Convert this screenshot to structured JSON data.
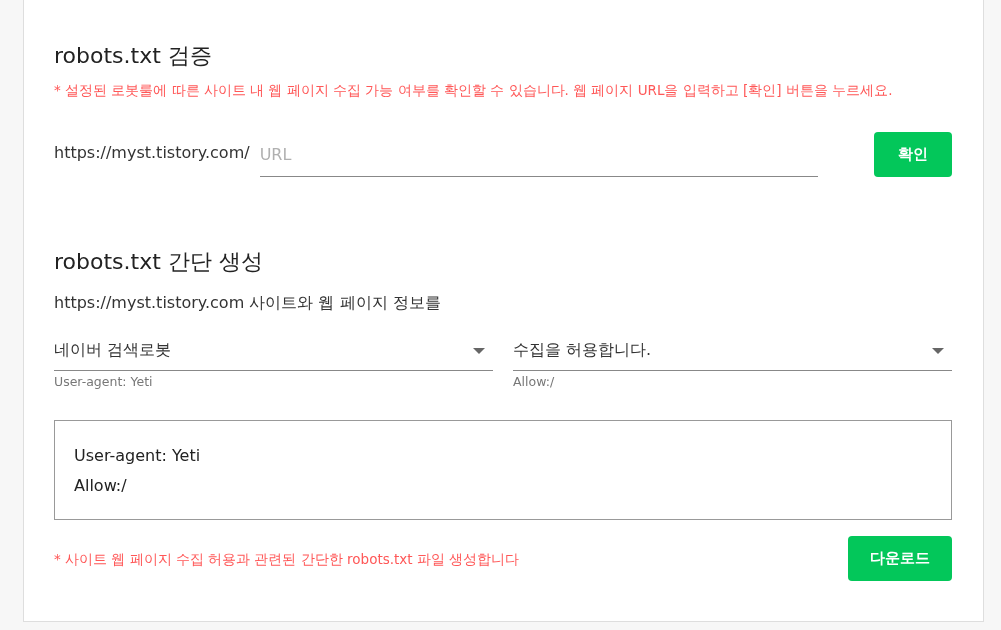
{
  "verify": {
    "title": "robots.txt 검증",
    "note": "* 설정된 로봇룰에 따른 사이트 내 웹 페이지 수집 가능 여부를 확인할 수 있습니다. 웹 페이지 URL을 입력하고 [확인] 버튼을 누르세요.",
    "url_prefix": "https://myst.tistory.com/",
    "url_field": {
      "placeholder": "URL"
    },
    "button": "확인"
  },
  "generate": {
    "title": "robots.txt 간단 생성",
    "description": "https://myst.tistory.com 사이트와 웹 페이지 정보를",
    "selects": [
      {
        "value": "네이버 검색로봇",
        "hint": "User-agent: Yeti"
      },
      {
        "value": "수집을 허용합니다.",
        "hint": "Allow:/"
      }
    ],
    "output_lines": [
      "User-agent: Yeti",
      "Allow:/"
    ],
    "note": "* 사이트 웹 페이지 수집 허용과 관련된 간단한 robots.txt 파일 생성합니다",
    "button": "다운로드"
  }
}
